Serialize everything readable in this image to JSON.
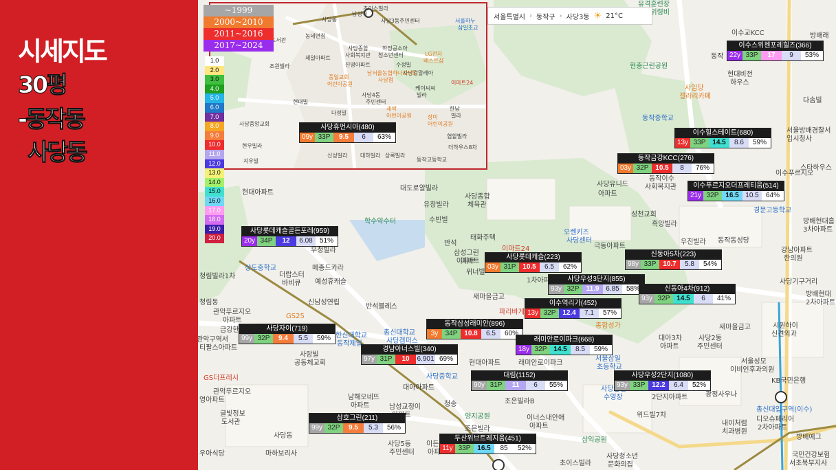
{
  "sidebar": {
    "title_line1": "시세지도",
    "title_line2": "30평",
    "title_line3": "-동작동",
    "title_line4": "사당동"
  },
  "colors": {
    "sidebar_bg": "#d21f26",
    "era_1999": "#a6a6a6",
    "era_2000_2010": "#f07b2f",
    "era_2011_2016": "#ee2d2d",
    "era_2017_2024": "#9a2dec"
  },
  "legend": {
    "eras": [
      {
        "label": "~1999",
        "color": "#a6a6a6"
      },
      {
        "label": "2000~2010",
        "color": "#f07b2f"
      },
      {
        "label": "2011~2016",
        "color": "#ee2d2d"
      },
      {
        "label": "2017~2024",
        "color": "#9a2dec"
      }
    ],
    "price_scale": [
      {
        "label": "1.0",
        "color": "#ffffff",
        "text": "#111"
      },
      {
        "label": "2.0",
        "color": "#ffe680",
        "text": "#111"
      },
      {
        "label": "3.0",
        "color": "#3fbf3f",
        "text": "#111"
      },
      {
        "label": "4.0",
        "color": "#1fa01f",
        "text": "#fff"
      },
      {
        "label": "5.0",
        "color": "#23b5e8",
        "text": "#fff"
      },
      {
        "label": "6.0",
        "color": "#1f78c8",
        "text": "#fff"
      },
      {
        "label": "7.0",
        "color": "#7030a0",
        "text": "#fff"
      },
      {
        "label": "8.0",
        "color": "#f5a623",
        "text": "#fff"
      },
      {
        "label": "9.0",
        "color": "#f57c3b",
        "text": "#fff"
      },
      {
        "label": "10.0",
        "color": "#ee2d2d",
        "text": "#fff"
      },
      {
        "label": "11.0",
        "color": "#b4a7f0",
        "text": "#fff"
      },
      {
        "label": "12.0",
        "color": "#4b3ae0",
        "text": "#fff"
      },
      {
        "label": "13.0",
        "color": "#f4f176",
        "text": "#111"
      },
      {
        "label": "14.0",
        "color": "#a3f06b",
        "text": "#111"
      },
      {
        "label": "15.0",
        "color": "#3fe0d0",
        "text": "#111"
      },
      {
        "label": "16.0",
        "color": "#6fd8f5",
        "text": "#111"
      },
      {
        "label": "17.0",
        "color": "#ff9cf2",
        "text": "#fff"
      },
      {
        "label": "18.0",
        "color": "#d46cf0",
        "text": "#fff"
      },
      {
        "label": "19.0",
        "color": "#3b1fa8",
        "text": "#fff"
      },
      {
        "label": "20.0",
        "color": "#d02040",
        "text": "#fff"
      }
    ]
  },
  "breadcrumb": {
    "city": "서울특별시",
    "district": "동작구",
    "dong": "사당3동",
    "weather": "21°C"
  },
  "apartments": [
    {
      "name": "사당휴먼시아(480)",
      "age": "09y",
      "age_color": "#f07b2f",
      "size": "33P",
      "price": "9.5",
      "price_color": "#f57c3b",
      "price2": "6",
      "price2_color": "#d9dcf5",
      "pct": "63%"
    },
    {
      "name": "이수스위첸포레힐즈(366)",
      "age": "22y",
      "age_color": "#9a2dec",
      "size": "33P",
      "price": "17",
      "price_color": "#ff9cf2",
      "price2": "9",
      "price2_color": "#d9dcf5",
      "pct": "53%"
    },
    {
      "name": "이수힐스테이트(680)",
      "age": "13y",
      "age_color": "#ee2d2d",
      "size": "33P",
      "price": "14.5",
      "price_color": "#3fe0d0",
      "price2": "8.6",
      "price2_color": "#d9dcf5",
      "pct": "59%"
    },
    {
      "name": "동작금강KCC(276)",
      "age": "03y",
      "age_color": "#f07b2f",
      "size": "32P",
      "price": "10.5",
      "price_color": "#ee2d2d",
      "price2": "8",
      "price2_color": "#d9dcf5",
      "pct": "76%"
    },
    {
      "name": "이수푸르지오더프레티움(514)",
      "age": "21y",
      "age_color": "#9a2dec",
      "size": "32P",
      "price": "16.5",
      "price_color": "#6fd8f5",
      "price2": "10.5",
      "price2_color": "#d9dcf5",
      "pct": "64%"
    },
    {
      "name": "사당롯데캐슬골든포레(959)",
      "age": "20y",
      "age_color": "#9a2dec",
      "size": "34P",
      "price": "12",
      "price_color": "#4b3ae0",
      "price2": "6.08",
      "price2_color": "#d9dcf5",
      "pct": "51%"
    },
    {
      "name": "사당롯데캐슬(223)",
      "age": "03y",
      "age_color": "#f07b2f",
      "size": "31P",
      "price": "10.5",
      "price_color": "#ee2d2d",
      "price2": "6.5",
      "price2_color": "#d9dcf5",
      "pct": "62%"
    },
    {
      "name": "신동아5차(223)",
      "age": "98y",
      "age_color": "#a6a6a6",
      "size": "33P",
      "price": "10.7",
      "price_color": "#ee2d2d",
      "price2": "5.8",
      "price2_color": "#d9dcf5",
      "pct": "54%"
    },
    {
      "name": "사당우성3단지(855)",
      "age": "93y",
      "age_color": "#a6a6a6",
      "size": "32P",
      "price": "11.9",
      "price_color": "#b4a7f0",
      "price2": "6.85",
      "price2_color": "#d9dcf5",
      "pct": "58%"
    },
    {
      "name": "신동아4차(912)",
      "age": "93y",
      "age_color": "#a6a6a6",
      "size": "32P",
      "price": "14.5",
      "price_color": "#3fe0d0",
      "price2": "6",
      "price2_color": "#d9dcf5",
      "pct": "41%"
    },
    {
      "name": "이수역리가(452)",
      "age": "13y",
      "age_color": "#ee2d2d",
      "size": "32P",
      "price": "12.4",
      "price_color": "#4b3ae0",
      "price2": "7.1",
      "price2_color": "#d9dcf5",
      "pct": "57%"
    },
    {
      "name": "동작삼성래미안(896)",
      "age": "3y",
      "age_color": "#f07b2f",
      "size": "34P",
      "price": "10.8",
      "price_color": "#ee2d2d",
      "price2": "6.5",
      "price2_color": "#d9dcf5",
      "pct": "60%"
    },
    {
      "name": "래미안로이파크(668)",
      "age": "18y",
      "age_color": "#9a2dec",
      "size": "32P",
      "price": "14.5",
      "price_color": "#3fe0d0",
      "price2": "8.5",
      "price2_color": "#d9dcf5",
      "pct": "59%"
    },
    {
      "name": "사당자이(719)",
      "age": "99y",
      "age_color": "#a6a6a6",
      "size": "32P",
      "price": "9.4",
      "price_color": "#f57c3b",
      "price2": "5.5",
      "price2_color": "#d9dcf5",
      "pct": "59%"
    },
    {
      "name": "경남아너스빌(340)",
      "age": "97y",
      "age_color": "#a6a6a6",
      "size": "31P",
      "price": "10",
      "price_color": "#ee2d2d",
      "price2": "6.901",
      "price2_color": "#d9dcf5",
      "pct": "69%"
    },
    {
      "name": "대림(1152)",
      "age": "90y",
      "age_color": "#a6a6a6",
      "size": "31P",
      "price": "11",
      "price_color": "#b4a7f0",
      "price2": "6",
      "price2_color": "#d9dcf5",
      "pct": "55%"
    },
    {
      "name": "사당우성2단지(1080)",
      "age": "93y",
      "age_color": "#a6a6a6",
      "size": "33P",
      "price": "12.2",
      "price_color": "#4b3ae0",
      "price2": "6.4",
      "price2_color": "#d9dcf5",
      "pct": "52%"
    },
    {
      "name": "삼호그린(211)",
      "age": "99y",
      "age_color": "#a6a6a6",
      "size": "32P",
      "price": "9.5",
      "price_color": "#f57c3b",
      "price2": "5.3",
      "price2_color": "#d9dcf5",
      "pct": "56%"
    },
    {
      "name": "두산위브트레지움(451)",
      "age": "11y",
      "age_color": "#ee2d2d",
      "size": "33P",
      "price": "16.5",
      "price_color": "#6fd8f5",
      "price2": "85",
      "price2_color": "#ffffff",
      "pct": "52%"
    }
  ],
  "places": [
    "유격훈련장",
    "전적위령비",
    "이수교KCC",
    "방배래",
    "동작",
    "현대비전",
    "하우스",
    "현충근린공원",
    "사임당",
    "갤러리카페",
    "다솜빌",
    "동작중학교",
    "서울방배경찰서",
    "임시청사",
    "이수푸르지오",
    "스타하우스",
    "동작이수",
    "사회복지관",
    "사당유니드",
    "아파트",
    "경문고등학교",
    "방배현대홈",
    "3차아파트",
    "성천교회",
    "대도로얄빌라",
    "사당종합",
    "체육관",
    "유창빌라",
    "수빈빌",
    "흑앙빌라",
    "우진빌라",
    "동작동성당",
    "학수약수터",
    "오렌키즈",
    "사당센터",
    "태화주택",
    "극동아파트",
    "반석",
    "삼성그린",
    "아파트",
    "위너빌",
    "1차아파트",
    "강남아파트",
    "한의원",
    "사당기구거리",
    "방배현대",
    "2차아파트",
    "새마을금고",
    "종합성가",
    "대아3차",
    "아파트",
    "사당2동",
    "주민센터",
    "시원하이",
    "신견외과",
    "새마을금고",
    "서울성모",
    "이비인후과의원",
    "KB국민은행",
    "총신대입구역(이수)",
    "현대아파트",
    "래미안로이파크",
    "서울삼일",
    "초등학교",
    "사당삼일",
    "수영장",
    "사당중학교",
    "조은빌라B",
    "2단지아파트",
    "광정사우나",
    "위드빌7차",
    "디오슈페리어",
    "2차아파트",
    "내이처럼",
    "치과병원",
    "방배예그",
    "국민건강보험",
    "서초북부지사",
    "청림빌라1차",
    "청림동",
    "관악푸르지오",
    "아파트",
    "더랍스터",
    "바비큐",
    "예성휴캐슬",
    "메종드카라",
    "우정빌라",
    "신남성연립",
    "반석블레스",
    "총신대학교",
    "사당캠퍼스",
    "한신대학교",
    "동작제일",
    "GS25",
    "금강한아파트",
    "관악구역서",
    "티팔스아파트",
    "사랑빌",
    "공동체교회",
    "GS더프레시",
    "관악푸르지오",
    "영아파트",
    "글빛정보",
    "도서관",
    "사당동",
    "남해오네뜨",
    "아파트",
    "남성교정이",
    "아파트",
    "대아아파트",
    "청송",
    "양지공원",
    "조은빌라",
    "이너스내안애",
    "아파트",
    "삼익공원",
    "사당청소년",
    "문화의집",
    "초이스빌라",
    "마하보리사",
    "사당5동",
    "주민센터",
    "이든",
    "아파트",
    "현대아파트",
    "상도중학교",
    "우아식당",
    "파리바게뜨",
    "이마트24",
    "아파트"
  ],
  "inset_places": [
    "초이스빌라",
    "서울하누",
    "삼일초교",
    "남성역",
    "사당3동주민센터",
    "사당동",
    "농네면칩",
    "도서관",
    "사당종합",
    "사회복지관",
    "하정공소아",
    "청소년센터",
    "LG전자",
    "베스트샵",
    "제일아파트",
    "진명아파트",
    "수정빌",
    "사당감말레아",
    "조원빌라",
    "남서울농협하나로마트",
    "사당점",
    "풍일교회",
    "어린이공원",
    "사당4동",
    "주민센터",
    "케이씨씨",
    "빌라",
    "이마트24",
    "현대빌",
    "다정빌",
    "새싹",
    "어린이공원",
    "한남",
    "빌라",
    "장미",
    "어린이공원",
    "협할빌라",
    "신성빌라",
    "대하빌라",
    "상록빌라",
    "현우빌라",
    "지우빌",
    "사당중앙교회",
    "동작고등학교",
    "더하우스8차"
  ]
}
